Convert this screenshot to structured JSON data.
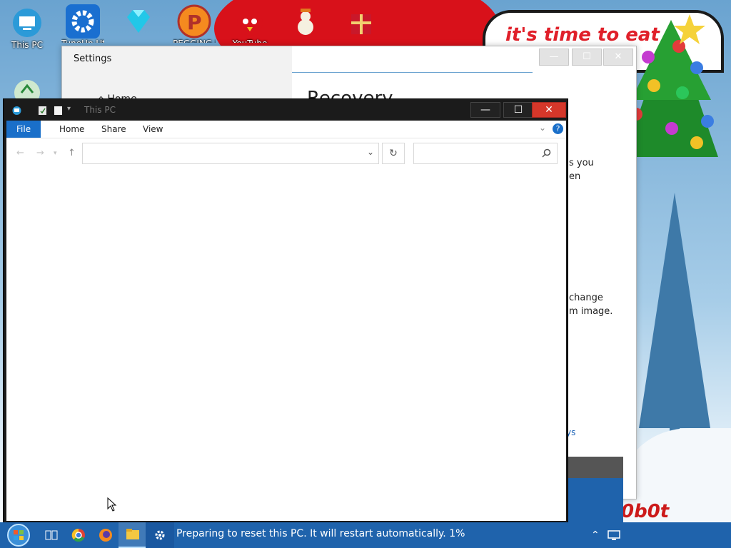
{
  "desktop": {
    "icons": [
      {
        "label": "This PC",
        "icon": "this-pc-icon"
      },
      {
        "label": "TuneUp Utilities",
        "icon": "gear-icon"
      },
      {
        "label": "",
        "icon": "diamond-icon"
      },
      {
        "label": "PEGGING LOL",
        "icon": "p-app-icon"
      },
      {
        "label": "YouTube",
        "icon": "angry-bird-icon"
      },
      {
        "label": "",
        "icon": "snowman-icon"
      },
      {
        "label": "",
        "icon": "gift-icon"
      }
    ],
    "recycle_icon": "recycle-bin-icon",
    "banner_text": "it's time to eat",
    "watermark": "0b0t",
    "colors": {
      "banner_text": "#e0202a",
      "taskbar": "#1f63ac"
    }
  },
  "settings_window": {
    "title": "Settings",
    "home_label": "Home",
    "heading": "Recovery",
    "fragments": [
      "s you",
      "en",
      "change",
      "m image."
    ],
    "link_fragment": "ys",
    "buttons": {
      "minimize": "—",
      "maximize": "☐",
      "close": "✕"
    }
  },
  "explorer_window": {
    "title": "This PC",
    "buttons": {
      "minimize": "—",
      "maximize": "☐",
      "close": "✕"
    },
    "ribbon_tabs": [
      "File",
      "Home",
      "Share",
      "View"
    ],
    "address_value": "",
    "search_placeholder": ""
  },
  "taskbar": {
    "message": "Preparing to reset this PC. It will restart automatically. 1%",
    "items": [
      "start-orb-icon",
      "task-view-icon",
      "chrome-icon",
      "firefox-icon",
      "file-explorer-icon",
      "settings-gear-icon"
    ],
    "tray": [
      "chevron-up-icon",
      "network-icon"
    ]
  }
}
